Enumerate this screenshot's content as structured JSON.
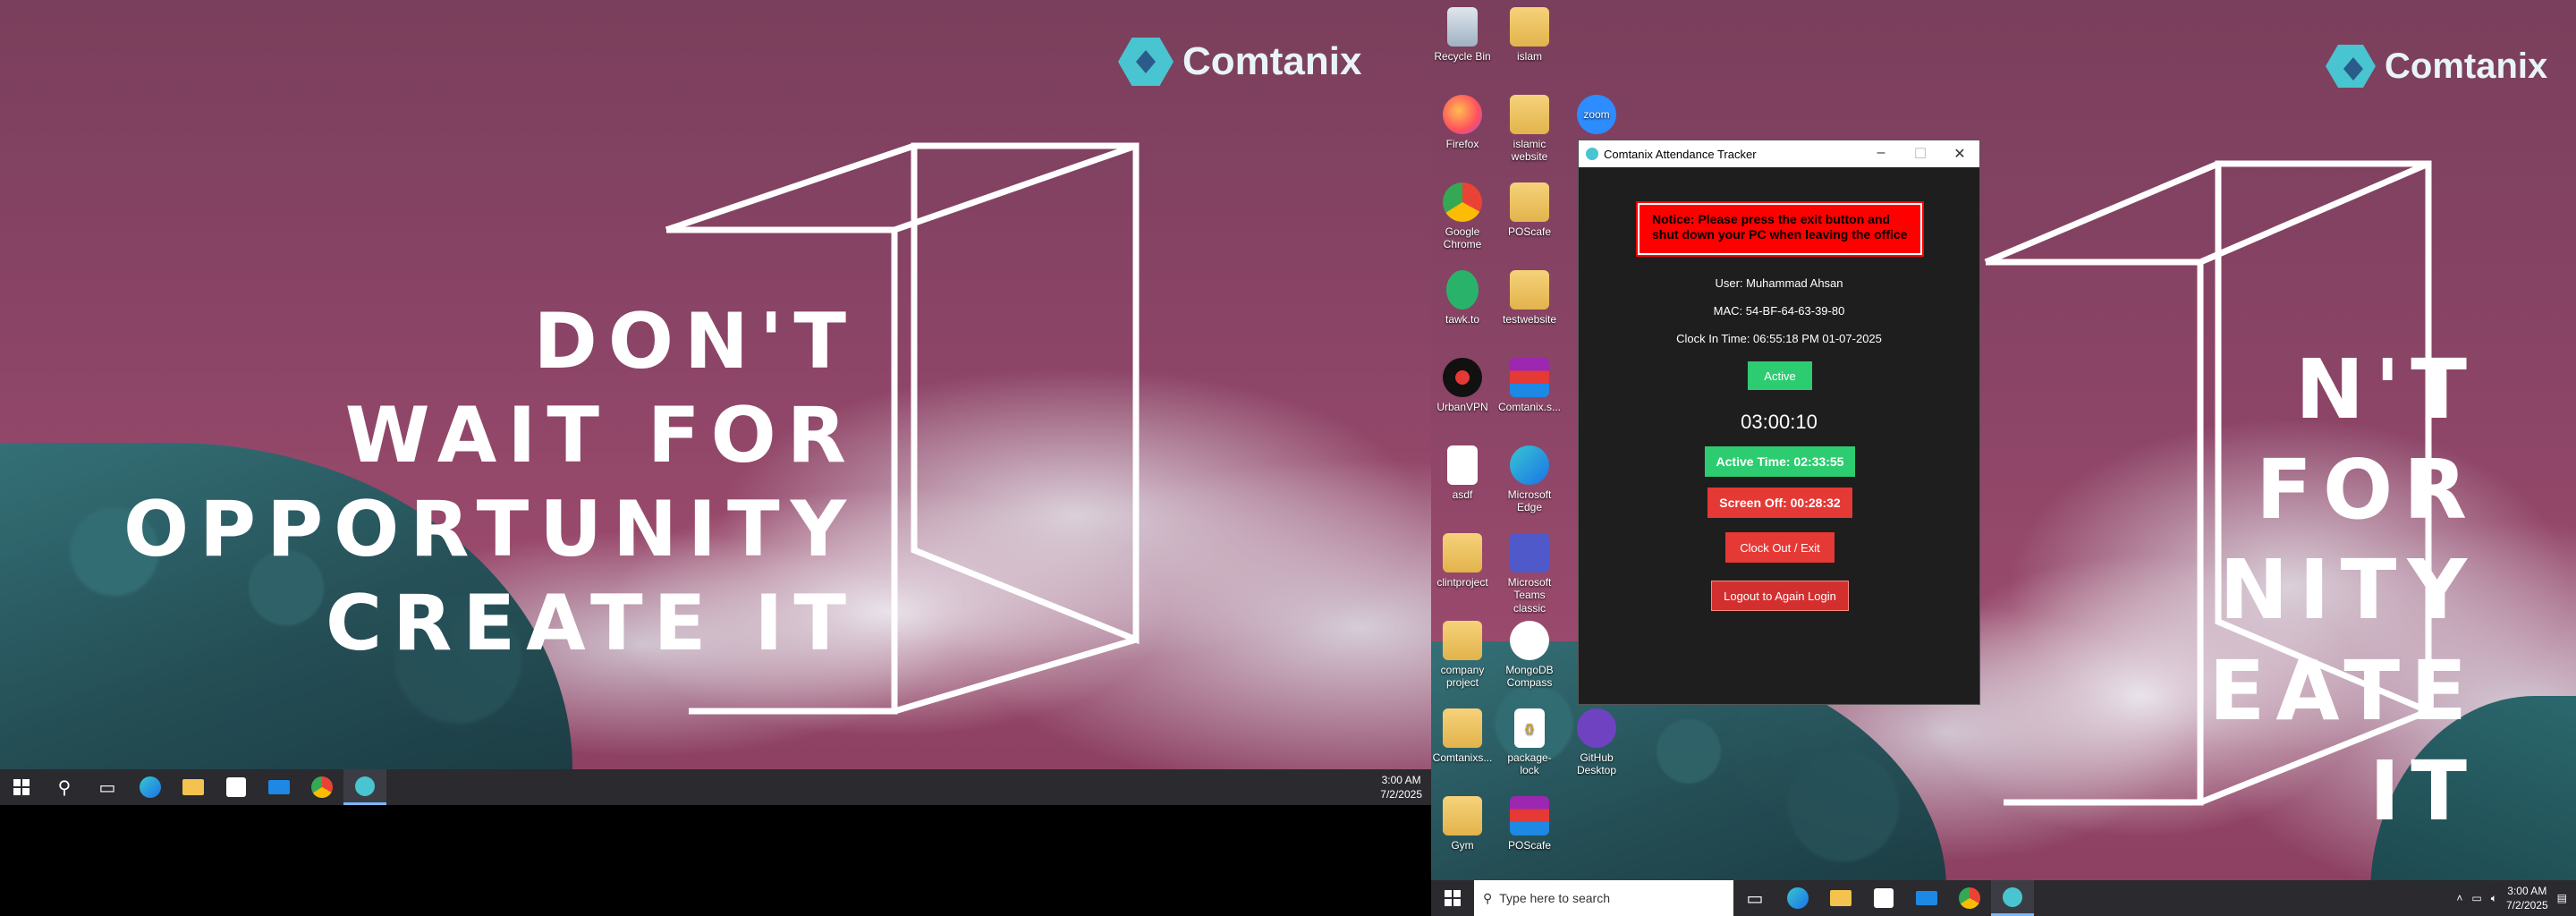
{
  "left_screen": {
    "logo_text": "Comtanix",
    "slogan_lines": [
      "DON'T",
      "WAIT FOR",
      "OPPORTUNITY",
      "CREATE IT"
    ],
    "taskbar": {
      "time": "3:00 AM",
      "date": "7/2/2025"
    }
  },
  "right_screen": {
    "logo_text": "Comtanix",
    "slogan_lines": [
      "N'T",
      "FOR",
      "NITY",
      "EATE IT"
    ],
    "desktop_icons": [
      {
        "label": "Recycle Bin",
        "icon": "recycle-bin-icon"
      },
      {
        "label": "islam",
        "icon": "folder-icon"
      },
      {
        "label": "Firefox",
        "icon": "firefox-icon"
      },
      {
        "label": "islamic website",
        "icon": "folder-icon"
      },
      {
        "label": "zoom",
        "icon": "zoom-icon"
      },
      {
        "label": "Google Chrome",
        "icon": "chrome-icon"
      },
      {
        "label": "POScafe",
        "icon": "folder-icon"
      },
      {
        "label": "tawk.to",
        "icon": "tawk-icon"
      },
      {
        "label": "testwebsite",
        "icon": "folder-icon"
      },
      {
        "label": "UrbanVPN",
        "icon": "vpn-icon"
      },
      {
        "label": "Comtanix.s...",
        "icon": "winrar-icon"
      },
      {
        "label": "asdf",
        "icon": "folder-icon"
      },
      {
        "label": "Microsoft Edge",
        "icon": "edge-icon"
      },
      {
        "label": "clintproject",
        "icon": "folder-icon"
      },
      {
        "label": "Microsoft Teams classic",
        "icon": "teams-icon"
      },
      {
        "label": "company project",
        "icon": "folder-icon"
      },
      {
        "label": "MongoDB Compass",
        "icon": "mongodb-icon"
      },
      {
        "label": "Comtanixs...",
        "icon": "folder-icon"
      },
      {
        "label": "package-lock",
        "icon": "json-file-icon"
      },
      {
        "label": "GitHub Desktop",
        "icon": "github-icon"
      },
      {
        "label": "Gym",
        "icon": "folder-icon"
      },
      {
        "label": "POScafe",
        "icon": "winrar-icon"
      }
    ],
    "window": {
      "title": "Comtanix Attendance Tracker",
      "notice": "Notice: Please press the exit button and shut down your PC when leaving the office",
      "user": "User: Muhammad Ahsan",
      "mac": "MAC: 54-BF-64-63-39-80",
      "clock_in": "Clock In Time: 06:55:18 PM 01-07-2025",
      "status": "Active",
      "timer": "03:00:10",
      "active_time": "Active Time: 02:33:55",
      "screen_off": "Screen Off: 00:28:32",
      "clock_out_label": "Clock Out / Exit",
      "logout_label": "Logout to Again Login"
    },
    "taskbar": {
      "search_placeholder": "Type here to search",
      "time": "3:00 AM",
      "date": "7/2/2025"
    }
  },
  "colors": {
    "status_green": "#2ecc71",
    "danger_red": "#e53935",
    "notice_red": "#ff0000",
    "accent_teal": "#48c5d0"
  }
}
